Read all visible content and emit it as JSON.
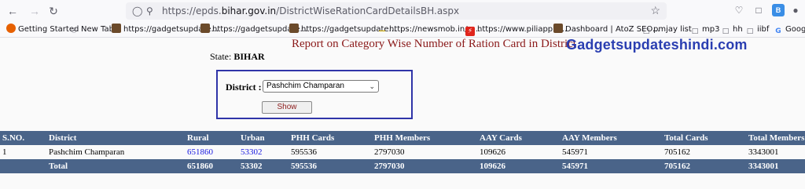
{
  "browser": {
    "url_prefix": "https://epds.",
    "url_domain": "bihar.gov.in",
    "url_path": "/DistrictWiseRationCardDetailsBH.aspx",
    "ext_badge": "B"
  },
  "bookmarks": [
    {
      "label": "Getting Started",
      "icon": "firefox-icon",
      "color": "#e66000"
    },
    {
      "label": "New Tab",
      "icon": "globe-icon",
      "color": "#5b5b66"
    },
    {
      "label": "https://gadgetsupdate...",
      "icon": "site-icon",
      "color": "#6b4a2a"
    },
    {
      "label": "https://gadgetsupdate...",
      "icon": "site-icon",
      "color": "#6b4a2a"
    },
    {
      "label": "https://gadgetsupdate...",
      "icon": "site-icon",
      "color": "#6b4a2a"
    },
    {
      "label": "https://newsmob.in/w...",
      "icon": "dash-icon",
      "color": "#c9a400"
    },
    {
      "label": "https://www.piliapp.c...",
      "icon": "lightning-icon",
      "color": "#e0241b"
    },
    {
      "label": "Dashboard | AtoZ SEO...",
      "icon": "site-icon",
      "color": "#6b4a2a"
    },
    {
      "label": "pmjay list",
      "icon": "folder-icon",
      "color": "#5b5b66"
    },
    {
      "label": "mp3",
      "icon": "folder-icon",
      "color": "#5b5b66"
    },
    {
      "label": "hh",
      "icon": "folder-icon",
      "color": "#5b5b66"
    },
    {
      "label": "iibf",
      "icon": "folder-icon",
      "color": "#5b5b66"
    },
    {
      "label": "Google",
      "icon": "google-icon",
      "color": "#4285f4"
    }
  ],
  "page": {
    "report_title": "Report on Category Wise Number of Ration Card in District",
    "watermark": "Gadgetsupdateshindi.com",
    "state_label": "State:",
    "state_value": "BIHAR",
    "district_label": "District :",
    "district_selected": "Pashchim Champaran",
    "show_button": "Show"
  },
  "table": {
    "headers": [
      "S.NO.",
      "District",
      "Rural",
      "Urban",
      "PHH Cards",
      "PHH Members",
      "AAY Cards",
      "AAY Members",
      "Total Cards",
      "Total Members"
    ],
    "rows": [
      [
        "1",
        "Pashchim Champaran",
        "651860",
        "53302",
        "595536",
        "2797030",
        "109626",
        "545971",
        "705162",
        "3343001"
      ]
    ],
    "total": [
      "",
      "Total",
      "651860",
      "53302",
      "595536",
      "2797030",
      "109626",
      "545971",
      "705162",
      "3343001"
    ]
  }
}
